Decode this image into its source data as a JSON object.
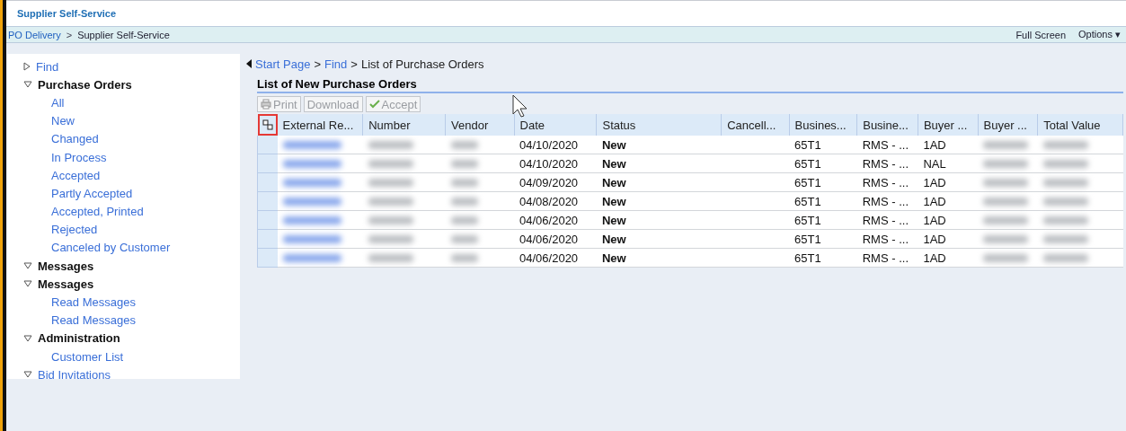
{
  "header": {
    "tab": "Supplier Self-Service"
  },
  "breadcrumb_bar": {
    "items": [
      "PO Delivery",
      "Supplier Self-Service"
    ],
    "separator": ">",
    "actions": [
      {
        "label": "Full Screen",
        "kind": "link"
      },
      {
        "label": "Options",
        "kind": "menu",
        "caret": "▾"
      }
    ]
  },
  "sidebar": {
    "items": [
      {
        "label": "Find",
        "kind": "link",
        "expanded": false
      },
      {
        "label": "Purchase Orders",
        "kind": "group",
        "expanded": true,
        "children": [
          {
            "label": "All"
          },
          {
            "label": "New"
          },
          {
            "label": "Changed"
          },
          {
            "label": "In Process"
          },
          {
            "label": "Accepted"
          },
          {
            "label": "Partly Accepted"
          },
          {
            "label": "Accepted, Printed"
          },
          {
            "label": "Rejected"
          },
          {
            "label": "Canceled by Customer"
          }
        ]
      },
      {
        "label": "Messages",
        "kind": "group",
        "expanded": true
      },
      {
        "label": "Messages",
        "kind": "group",
        "expanded": true,
        "children": [
          {
            "label": "Read Messages"
          },
          {
            "label": "Read Messages"
          }
        ]
      },
      {
        "label": "Administration",
        "kind": "group",
        "expanded": true,
        "children": [
          {
            "label": "Customer List"
          }
        ]
      },
      {
        "label": "Bid Invitations",
        "kind": "link",
        "expanded": true
      }
    ]
  },
  "path": {
    "links": [
      "Start Page",
      "Find"
    ],
    "separator": ">",
    "current": "List of Purchase Orders"
  },
  "table": {
    "title": "List of New Purchase Orders",
    "toolbar": [
      {
        "label": "Print",
        "kind": "print",
        "disabled": true
      },
      {
        "label": "Download",
        "kind": "plain",
        "disabled": true
      },
      {
        "label": "Accept",
        "kind": "accept",
        "disabled": true
      }
    ],
    "columns": [
      {
        "label": "External Re...",
        "blurred": true
      },
      {
        "label": "Number",
        "blurred": true
      },
      {
        "label": "Vendor",
        "blurred": true
      },
      {
        "label": "Date",
        "blurred": false
      },
      {
        "label": "Status",
        "blurred": false
      },
      {
        "label": "Cancell...",
        "blurred": false
      },
      {
        "label": "Busines...",
        "blurred": false
      },
      {
        "label": "Busine...",
        "blurred": false
      },
      {
        "label": "Buyer ...",
        "blurred": false
      },
      {
        "label": "Buyer ...",
        "blurred": true
      },
      {
        "label": "Total Value",
        "blurred": true
      }
    ],
    "rows": [
      {
        "date": "04/10/2020",
        "status": "New",
        "business_1": "65T1",
        "business_2": "RMS - ...",
        "buyer_1": "1AD"
      },
      {
        "date": "04/10/2020",
        "status": "New",
        "business_1": "65T1",
        "business_2": "RMS - ...",
        "buyer_1": "NAL"
      },
      {
        "date": "04/09/2020",
        "status": "New",
        "business_1": "65T1",
        "business_2": "RMS - ...",
        "buyer_1": "1AD"
      },
      {
        "date": "04/08/2020",
        "status": "New",
        "business_1": "65T1",
        "business_2": "RMS - ...",
        "buyer_1": "1AD"
      },
      {
        "date": "04/06/2020",
        "status": "New",
        "business_1": "65T1",
        "business_2": "RMS - ...",
        "buyer_1": "1AD"
      },
      {
        "date": "04/06/2020",
        "status": "New",
        "business_1": "65T1",
        "business_2": "RMS - ...",
        "buyer_1": "1AD"
      },
      {
        "date": "04/06/2020",
        "status": "New",
        "business_1": "65T1",
        "business_2": "RMS - ...",
        "buyer_1": "1AD"
      }
    ]
  }
}
